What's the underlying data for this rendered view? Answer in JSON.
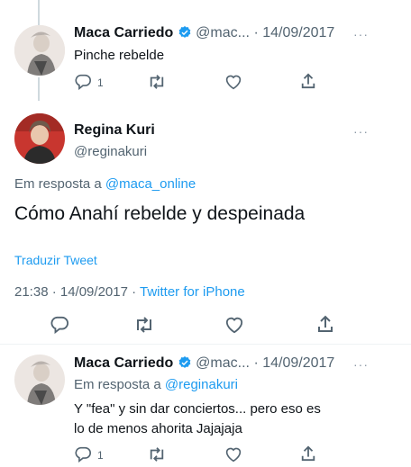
{
  "tweet1": {
    "name": "Maca Carriedo",
    "handle": "@mac...",
    "sep": "·",
    "date": "14/09/2017",
    "text": "Pinche rebelde",
    "reply_count": "1",
    "more": "···"
  },
  "main_tweet": {
    "name": "Regina Kuri",
    "handle": "@reginakuri",
    "reply_prefix": "Em resposta a",
    "reply_to": "@maca_online",
    "text": "Cómo Anahí rebelde y despeinada",
    "translate": "Traduzir Tweet",
    "time": "21:38 · 14/09/2017 · ",
    "source": "Twitter for iPhone",
    "more": "···"
  },
  "tweet3": {
    "name": "Maca Carriedo",
    "handle": "@mac...",
    "sep": "·",
    "date": "14/09/2017",
    "reply_prefix": "Em resposta a",
    "reply_to": "@reginakuri",
    "text_line1": "Y \"fea\" y sin dar conciertos... pero eso es",
    "text_line2": "lo de menos ahorita Jajajaja",
    "reply_count": "1",
    "more": "···"
  },
  "colors": {
    "accent": "#1d9bf0",
    "muted": "#536471",
    "line": "#cfd9de"
  }
}
